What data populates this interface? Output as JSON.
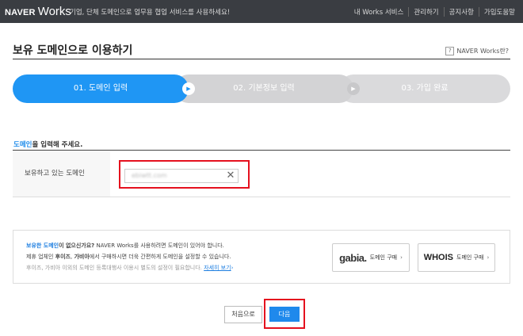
{
  "header": {
    "logo_naver": "NAVER",
    "logo_works": "Works",
    "tagline": "기업, 단체 도메인으로 업무용 협업 서비스를 사용하세요!",
    "nav": [
      "내 Works 서비스",
      "관리하기",
      "공지사항",
      "가입도움말"
    ]
  },
  "page": {
    "title": "보유 도메인으로 이용하기",
    "help_link": "NAVER Works란?",
    "help_icon_glyph": "?"
  },
  "steps": [
    {
      "label": "01. 도메인 입력",
      "state": "active"
    },
    {
      "label": "02. 기본정보 입력",
      "state": "inactive"
    },
    {
      "label": "03. 가입 완료",
      "state": "inactive"
    }
  ],
  "form": {
    "section_label_highlight": "도메인",
    "section_label_rest": "을 입력해 주세요.",
    "field_label": "보유하고 있는 도메인",
    "domain_value": "ebiwtt.com",
    "clear_glyph": "✕"
  },
  "promo": {
    "line1_highlight": "보유한 도메인",
    "line1_bold": "이 없으신가요?",
    "line1_rest": " NAVER Works를 사용하려면 도메인이 있어야 합니다.",
    "line2_pre": "제휴 업체인 ",
    "line2_b1": "후이즈",
    "line2_mid": ", ",
    "line2_b2": "가비아",
    "line2_rest": "에서 구매하시면 더욱 간편하게 도메인을 설정할 수 있습니다.",
    "line3_text": "후이즈, 가비아 이외의 도메인 등록대행사 이용시 별도의 설정이 필요합니다. ",
    "line3_link": "자세히 보기",
    "line3_chevron": "›",
    "gabia_logo": "gabia.",
    "gabia_label": "도메인 구매",
    "whois_logo": "WHOIS",
    "whois_label": "도메인 구매",
    "chevron": "›"
  },
  "buttons": {
    "prev": "처음으로",
    "next": "다음"
  },
  "colors": {
    "accent": "#1f96f4",
    "highlight_box": "#e5101e",
    "topbar": "#3a3d42"
  }
}
